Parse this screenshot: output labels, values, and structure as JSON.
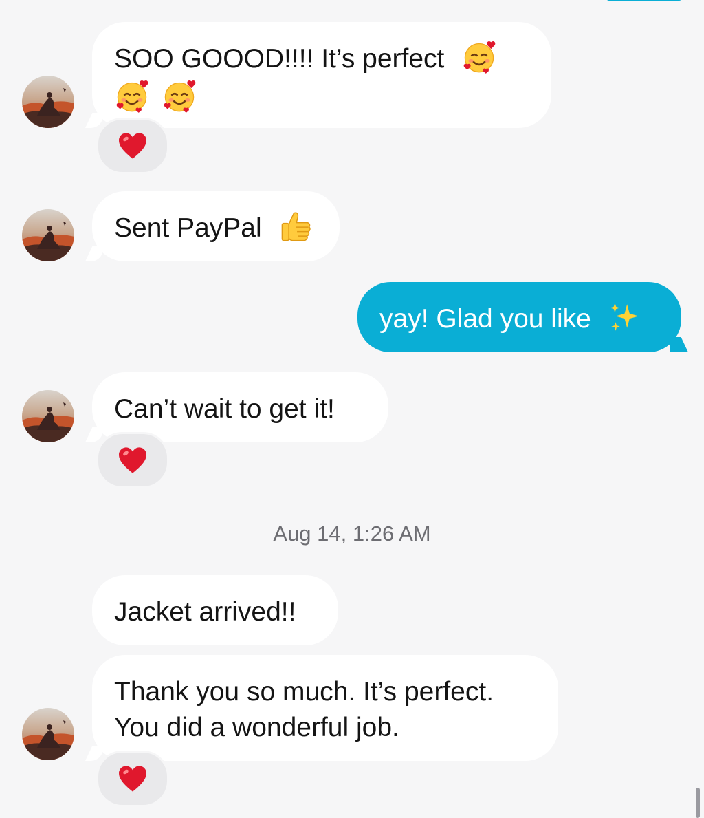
{
  "messages": [
    {
      "id": "m1",
      "direction": "incoming",
      "text": "SOO GOOOD!!!! It’s perfect",
      "emojis": [
        "smiling-face-with-hearts",
        "smiling-face-with-hearts",
        "smiling-face-with-hearts"
      ],
      "reaction": "red-heart"
    },
    {
      "id": "m2",
      "direction": "incoming",
      "text": "Sent PayPal",
      "emojis": [
        "thumbs-up"
      ]
    },
    {
      "id": "m3",
      "direction": "outgoing",
      "text": "yay! Glad you like",
      "emojis": [
        "sparkles"
      ]
    },
    {
      "id": "m4",
      "direction": "incoming",
      "text": "Can’t wait to get it!",
      "reaction": "red-heart"
    },
    {
      "id": "m5",
      "direction": "incoming",
      "text": "Jacket arrived!!"
    },
    {
      "id": "m6",
      "direction": "incoming",
      "line1": "Thank you so much. It’s perfect.",
      "line2": "You did a wonderful job.",
      "reaction": "red-heart"
    }
  ],
  "timestamp": "Aug 14, 1:26 AM",
  "colors": {
    "background": "#f6f6f7",
    "incoming_bubble": "#ffffff",
    "outgoing_bubble": "#0aaed5",
    "reaction_pill": "#e9e9eb",
    "heart": "#e0182d"
  }
}
